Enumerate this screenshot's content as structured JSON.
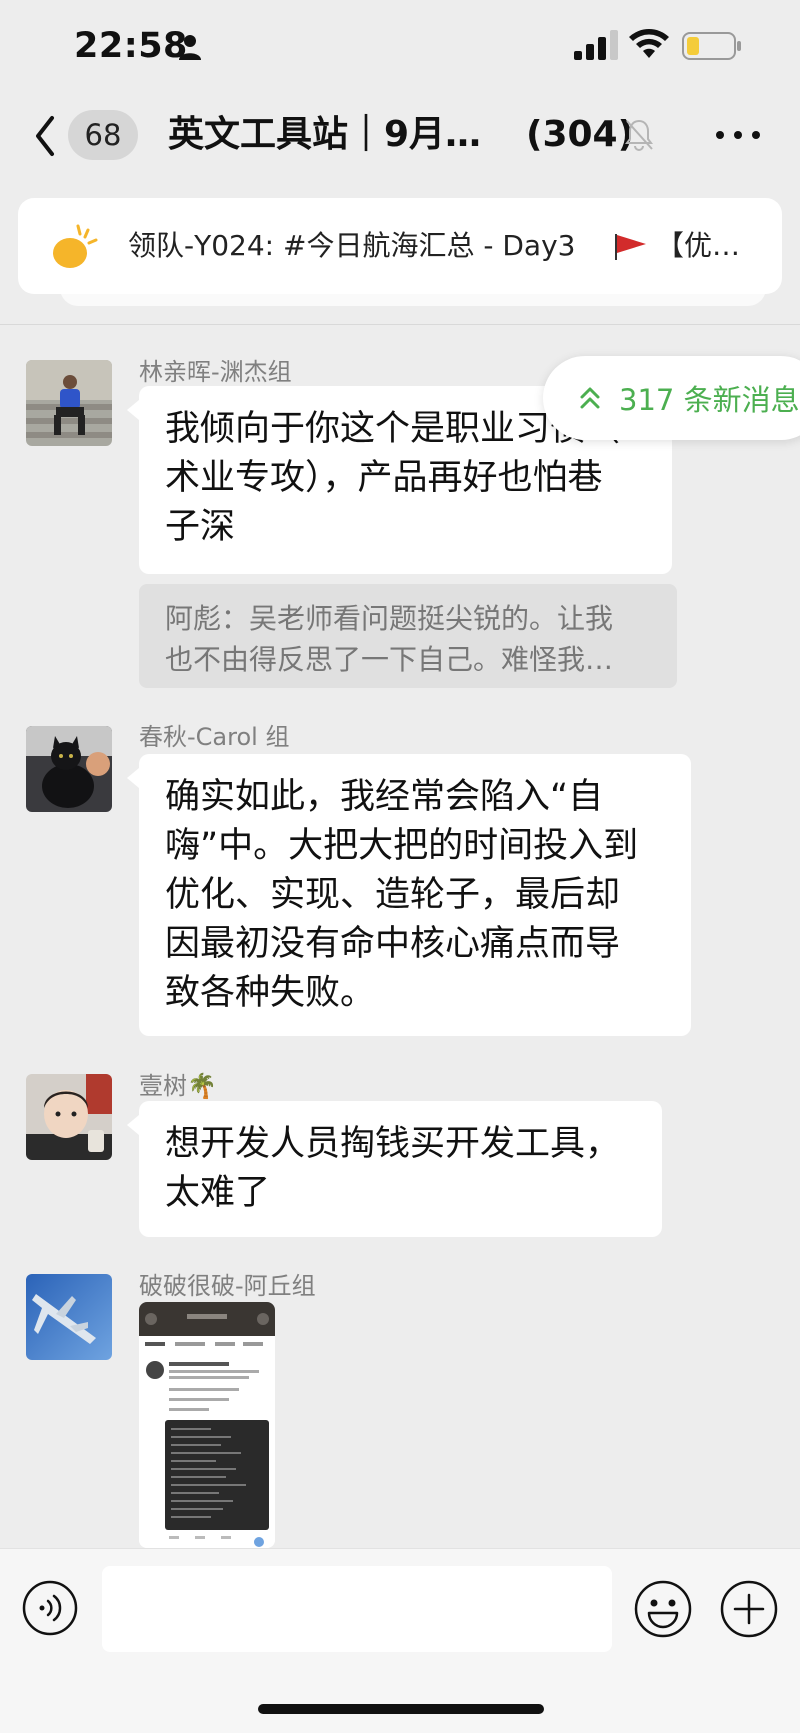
{
  "status_bar": {
    "time": "22:58"
  },
  "nav": {
    "unread_count": "68",
    "title": "英文工具站｜9月…",
    "member_count": "(304)"
  },
  "pinned": {
    "text": "领队-Y024: #今日航海汇总 - Day3",
    "text_after_flag": "【优…"
  },
  "new_messages_badge": "317 条新消息",
  "messages": [
    {
      "sender": "林亲晖-渊杰组",
      "lines": [
        "我倾向于你这个是职业习惯（",
        "术业专攻），产品再好也怕巷",
        "子深"
      ],
      "quote_lines": [
        "阿彪：吴老师看问题挺尖锐的。让我",
        "也不由得反思了一下自己。难怪我…"
      ]
    },
    {
      "sender": "春秋-Carol 组",
      "lines": [
        "确实如此，我经常会陷入“自",
        "嗨”中。大把大把的时间投入到",
        "优化、实现、造轮子，最后却",
        "因最初没有命中核心痛点而导",
        "致各种失败。"
      ]
    },
    {
      "sender": "壹树🌴",
      "lines": [
        "想开发人员掏钱买开发工具，",
        "太难了"
      ]
    },
    {
      "sender": "破破很破-阿丘组",
      "image_alt": "screenshot-thumbnail"
    }
  ],
  "input": {
    "placeholder": ""
  },
  "colors": {
    "accent_green": "#4caf50",
    "background": "#ededed"
  }
}
